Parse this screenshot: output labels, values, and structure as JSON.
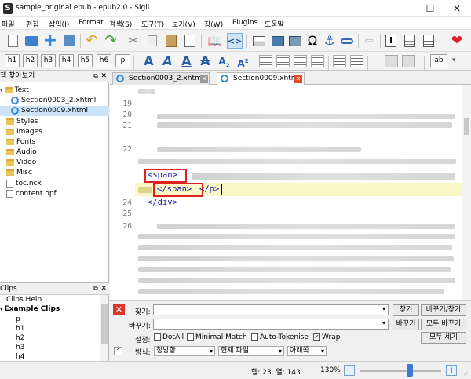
{
  "window": {
    "title": "sample_original.epub - epub2.0 - Sigil",
    "minimize": "—",
    "maximize": "☐",
    "close": "✕"
  },
  "menu": [
    "파일",
    "편집",
    "삽입(I)",
    "Format",
    "검색(S)",
    "도구(T)",
    "보기(V)",
    "창(W)",
    "Plugins",
    "도움말"
  ],
  "headings": [
    "h1",
    "h2",
    "h3",
    "h4",
    "h5",
    "h6",
    "p"
  ],
  "toolbar2": {
    "ab_label": "ab"
  },
  "book_browser": {
    "title": "책 찾아보기",
    "items": [
      {
        "label": "Text",
        "kind": "folder"
      },
      {
        "label": "Section0003_2.xhtml",
        "kind": "xhtml"
      },
      {
        "label": "Section0009.xhtml",
        "kind": "xhtml"
      },
      {
        "label": "Styles",
        "kind": "folder"
      },
      {
        "label": "Images",
        "kind": "folder"
      },
      {
        "label": "Fonts",
        "kind": "folder"
      },
      {
        "label": "Audio",
        "kind": "folder"
      },
      {
        "label": "Video",
        "kind": "folder"
      },
      {
        "label": "Misc",
        "kind": "folder"
      },
      {
        "label": "toc.ncx",
        "kind": "file"
      },
      {
        "label": "content.opf",
        "kind": "file"
      }
    ]
  },
  "clips": {
    "title": "Clips",
    "items": [
      "Clips Help",
      "Example Clips",
      "p",
      "h1",
      "h2",
      "h3",
      "h4"
    ]
  },
  "tabs": [
    {
      "label": "Section0003_2.xhtml",
      "active": false
    },
    {
      "label": "Section0009.xhtml",
      "active": true
    }
  ],
  "editor": {
    "line_numbers": [
      "19",
      "20",
      "21",
      "22",
      "",
      "",
      "",
      "24",
      "25",
      "26"
    ],
    "span_open": "<span>",
    "span_close": "</span>",
    "p_close": "</p>",
    "div_close": "</div>"
  },
  "find": {
    "find_label": "찾기:",
    "replace_label": "바꾸기:",
    "find_button": "찾기",
    "replace_find_button": "바꾸기/찾기",
    "replace_button": "바꾸기",
    "replace_all_button": "모두 바꾸기",
    "count_all_button": "모두 세기",
    "settings_label": "설정:",
    "options": [
      {
        "label": "DotAll",
        "checked": false
      },
      {
        "label": "Minimal Match",
        "checked": false
      },
      {
        "label": "Auto-Tokenise",
        "checked": false
      },
      {
        "label": "Wrap",
        "checked": true
      }
    ],
    "mode_label": "방식:",
    "mode_value": "정방향",
    "scope_value": "현재 파일",
    "direction_value": "아래쪽"
  },
  "status": {
    "position": "행: 23, 열: 143",
    "zoom": "130%",
    "zoom_fraction": 0.62
  }
}
